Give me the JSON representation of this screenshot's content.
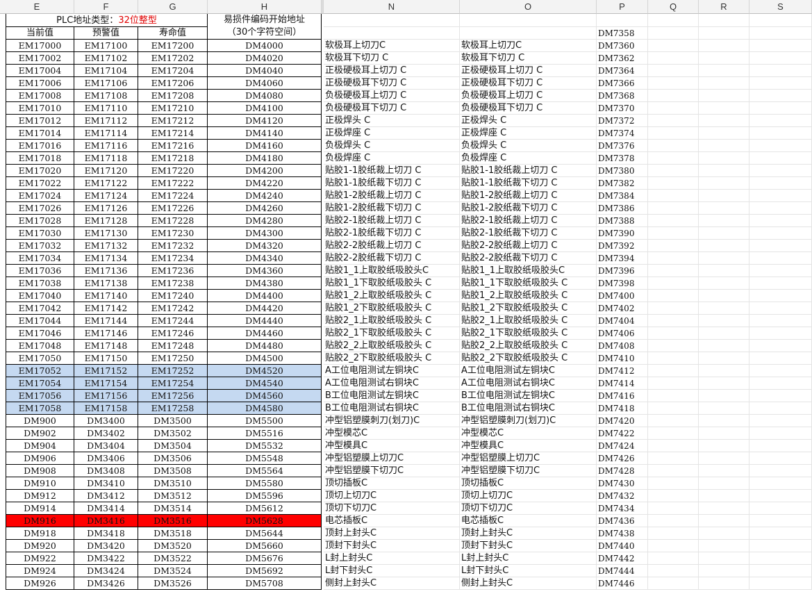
{
  "columns": [
    "E",
    "F",
    "G",
    "H",
    "",
    "N",
    "O",
    "P",
    "Q",
    "R",
    "S"
  ],
  "header": {
    "plc_type_label": "PLC地址类型：",
    "plc_type_value": "32位整型",
    "spare_code_line1": "易损件编码开始地址",
    "spare_code_line2": "（30个字符空间）",
    "col_current": "当前值",
    "col_warning": "预警值",
    "col_life": "寿命值",
    "p_first": "DM7358"
  },
  "rows": [
    [
      "EM17000",
      "EM17100",
      "EM17200",
      "DM4000",
      "软极耳上切刀C",
      "软极耳上切刀C",
      "DM7360"
    ],
    [
      "EM17002",
      "EM17102",
      "EM17202",
      "DM4020",
      "软极耳下切刀 C",
      "软极耳下切刀 C",
      "DM7362"
    ],
    [
      "EM17004",
      "EM17104",
      "EM17204",
      "DM4040",
      "正极硬极耳上切刀 C",
      "正极硬极耳上切刀 C",
      "DM7364"
    ],
    [
      "EM17006",
      "EM17106",
      "EM17206",
      "DM4060",
      "正极硬极耳下切刀 C",
      "正极硬极耳下切刀 C",
      "DM7366"
    ],
    [
      "EM17008",
      "EM17108",
      "EM17208",
      "DM4080",
      "负极硬极耳上切刀 C",
      "负极硬极耳上切刀 C",
      "DM7368"
    ],
    [
      "EM17010",
      "EM17110",
      "EM17210",
      "DM4100",
      "负极硬极耳下切刀 C",
      "负极硬极耳下切刀 C",
      "DM7370"
    ],
    [
      "EM17012",
      "EM17112",
      "EM17212",
      "DM4120",
      "正极焊头 C",
      "正极焊头 C",
      "DM7372"
    ],
    [
      "EM17014",
      "EM17114",
      "EM17214",
      "DM4140",
      "正极焊座 C",
      "正极焊座 C",
      "DM7374"
    ],
    [
      "EM17016",
      "EM17116",
      "EM17216",
      "DM4160",
      "负极焊头 C",
      "负极焊头 C",
      "DM7376"
    ],
    [
      "EM17018",
      "EM17118",
      "EM17218",
      "DM4180",
      "负极焊座 C",
      "负极焊座 C",
      "DM7378"
    ],
    [
      "EM17020",
      "EM17120",
      "EM17220",
      "DM4200",
      "贴胶1-1胶纸裁上切刀 C",
      "贴胶1-1胶纸裁上切刀 C",
      "DM7380"
    ],
    [
      "EM17022",
      "EM17122",
      "EM17222",
      "DM4220",
      "贴胶1-1胶纸裁下切刀 C",
      "贴胶1-1胶纸裁下切刀 C",
      "DM7382"
    ],
    [
      "EM17024",
      "EM17124",
      "EM17224",
      "DM4240",
      "贴胶1-2胶纸裁上切刀 C",
      "贴胶1-2胶纸裁上切刀 C",
      "DM7384"
    ],
    [
      "EM17026",
      "EM17126",
      "EM17226",
      "DM4260",
      "贴胶1-2胶纸裁下切刀 C",
      "贴胶1-2胶纸裁下切刀 C",
      "DM7386"
    ],
    [
      "EM17028",
      "EM17128",
      "EM17228",
      "DM4280",
      "贴胶2-1胶纸裁上切刀 C",
      "贴胶2-1胶纸裁上切刀 C",
      "DM7388"
    ],
    [
      "EM17030",
      "EM17130",
      "EM17230",
      "DM4300",
      "贴胶2-1胶纸裁下切刀 C",
      "贴胶2-1胶纸裁下切刀 C",
      "DM7390"
    ],
    [
      "EM17032",
      "EM17132",
      "EM17232",
      "DM4320",
      "贴胶2-2胶纸裁上切刀 C",
      "贴胶2-2胶纸裁上切刀 C",
      "DM7392"
    ],
    [
      "EM17034",
      "EM17134",
      "EM17234",
      "DM4340",
      "贴胶2-2胶纸裁下切刀 C",
      "贴胶2-2胶纸裁下切刀 C",
      "DM7394"
    ],
    [
      "EM17036",
      "EM17136",
      "EM17236",
      "DM4360",
      "贴胶1_1上取胶纸吸胶头C",
      "贴胶1_1上取胶纸吸胶头C",
      "DM7396"
    ],
    [
      "EM17038",
      "EM17138",
      "EM17238",
      "DM4380",
      "贴胶1_1下取胶纸吸胶头 C",
      "贴胶1_1下取胶纸吸胶头 C",
      "DM7398"
    ],
    [
      "EM17040",
      "EM17140",
      "EM17240",
      "DM4400",
      "贴胶1_2上取胶纸吸胶头 C",
      "贴胶1_2上取胶纸吸胶头 C",
      "DM7400"
    ],
    [
      "EM17042",
      "EM17142",
      "EM17242",
      "DM4420",
      "贴胶1_2下取胶纸吸胶头 C",
      "贴胶1_2下取胶纸吸胶头 C",
      "DM7402"
    ],
    [
      "EM17044",
      "EM17144",
      "EM17244",
      "DM4440",
      "贴胶2_1上取胶纸吸胶头 C",
      "贴胶2_1上取胶纸吸胶头 C",
      "DM7404"
    ],
    [
      "EM17046",
      "EM17146",
      "EM17246",
      "DM4460",
      "贴胶2_1下取胶纸吸胶头 C",
      "贴胶2_1下取胶纸吸胶头 C",
      "DM7406"
    ],
    [
      "EM17048",
      "EM17148",
      "EM17248",
      "DM4480",
      "贴胶2_2上取胶纸吸胶头 C",
      "贴胶2_2上取胶纸吸胶头 C",
      "DM7408"
    ],
    [
      "EM17050",
      "EM17150",
      "EM17250",
      "DM4500",
      "贴胶2_2下取胶纸吸胶头 C",
      "贴胶2_2下取胶纸吸胶头 C",
      "DM7410"
    ],
    [
      "EM17052",
      "EM17152",
      "EM17252",
      "DM4520",
      "A工位电阻测试左铜块C",
      "A工位电阻测试左铜块C",
      "DM7412"
    ],
    [
      "EM17054",
      "EM17154",
      "EM17254",
      "DM4540",
      "A工位电阻测试右铜块C",
      "A工位电阻测试右铜块C",
      "DM7414"
    ],
    [
      "EM17056",
      "EM17156",
      "EM17256",
      "DM4560",
      "B工位电阻测试左铜块C",
      "B工位电阻测试左铜块C",
      "DM7416"
    ],
    [
      "EM17058",
      "EM17158",
      "EM17258",
      "DM4580",
      "B工位电阻测试右铜块C",
      "B工位电阻测试右铜块C",
      "DM7418"
    ],
    [
      "DM900",
      "DM3400",
      "DM3500",
      "DM5500",
      "冲型铝塑膜刺刀(划刀)C",
      "冲型铝塑膜刺刀(划刀)C",
      "DM7420"
    ],
    [
      "DM902",
      "DM3402",
      "DM3502",
      "DM5516",
      "冲型模芯C",
      "冲型模芯C",
      "DM7422"
    ],
    [
      "DM904",
      "DM3404",
      "DM3504",
      "DM5532",
      "冲型模具C",
      "冲型模具C",
      "DM7424"
    ],
    [
      "DM906",
      "DM3406",
      "DM3506",
      "DM5548",
      "冲型铝塑膜上切刀C",
      "冲型铝塑膜上切刀C",
      "DM7426"
    ],
    [
      "DM908",
      "DM3408",
      "DM3508",
      "DM5564",
      "冲型铝塑膜下切刀C",
      "冲型铝塑膜下切刀C",
      "DM7428"
    ],
    [
      "DM910",
      "DM3410",
      "DM3510",
      "DM5580",
      "顶切插板C",
      "顶切插板C",
      "DM7430"
    ],
    [
      "DM912",
      "DM3412",
      "DM3512",
      "DM5596",
      "顶切上切刀C",
      "顶切上切刀C",
      "DM7432"
    ],
    [
      "DM914",
      "DM3414",
      "DM3514",
      "DM5612",
      "顶切下切刀C",
      "顶切下切刀C",
      "DM7434"
    ],
    [
      "DM916",
      "DM3416",
      "DM3516",
      "DM5628",
      "电芯插板C",
      "电芯插板C",
      "DM7436"
    ],
    [
      "DM918",
      "DM3418",
      "DM3518",
      "DM5644",
      "顶封上封头C",
      "顶封上封头C",
      "DM7438"
    ],
    [
      "DM920",
      "DM3420",
      "DM3520",
      "DM5660",
      "顶封下封头C",
      "顶封下封头C",
      "DM7440"
    ],
    [
      "DM922",
      "DM3422",
      "DM3522",
      "DM5676",
      "L封上封头C",
      "L封上封头C",
      "DM7442"
    ],
    [
      "DM924",
      "DM3424",
      "DM3524",
      "DM5692",
      "L封下封头C",
      "L封下封头C",
      "DM7444"
    ],
    [
      "DM926",
      "DM3426",
      "DM3526",
      "DM5708",
      "侧封上封头C",
      "侧封上封头C",
      "DM7446"
    ]
  ],
  "highlight_blue_rows": [
    26,
    27,
    28,
    29
  ],
  "highlight_red_rows": [
    38
  ],
  "colors": {
    "highlight_blue": "#c5d9f1",
    "highlight_red": "#ff0000",
    "type_text": "#e00000"
  }
}
